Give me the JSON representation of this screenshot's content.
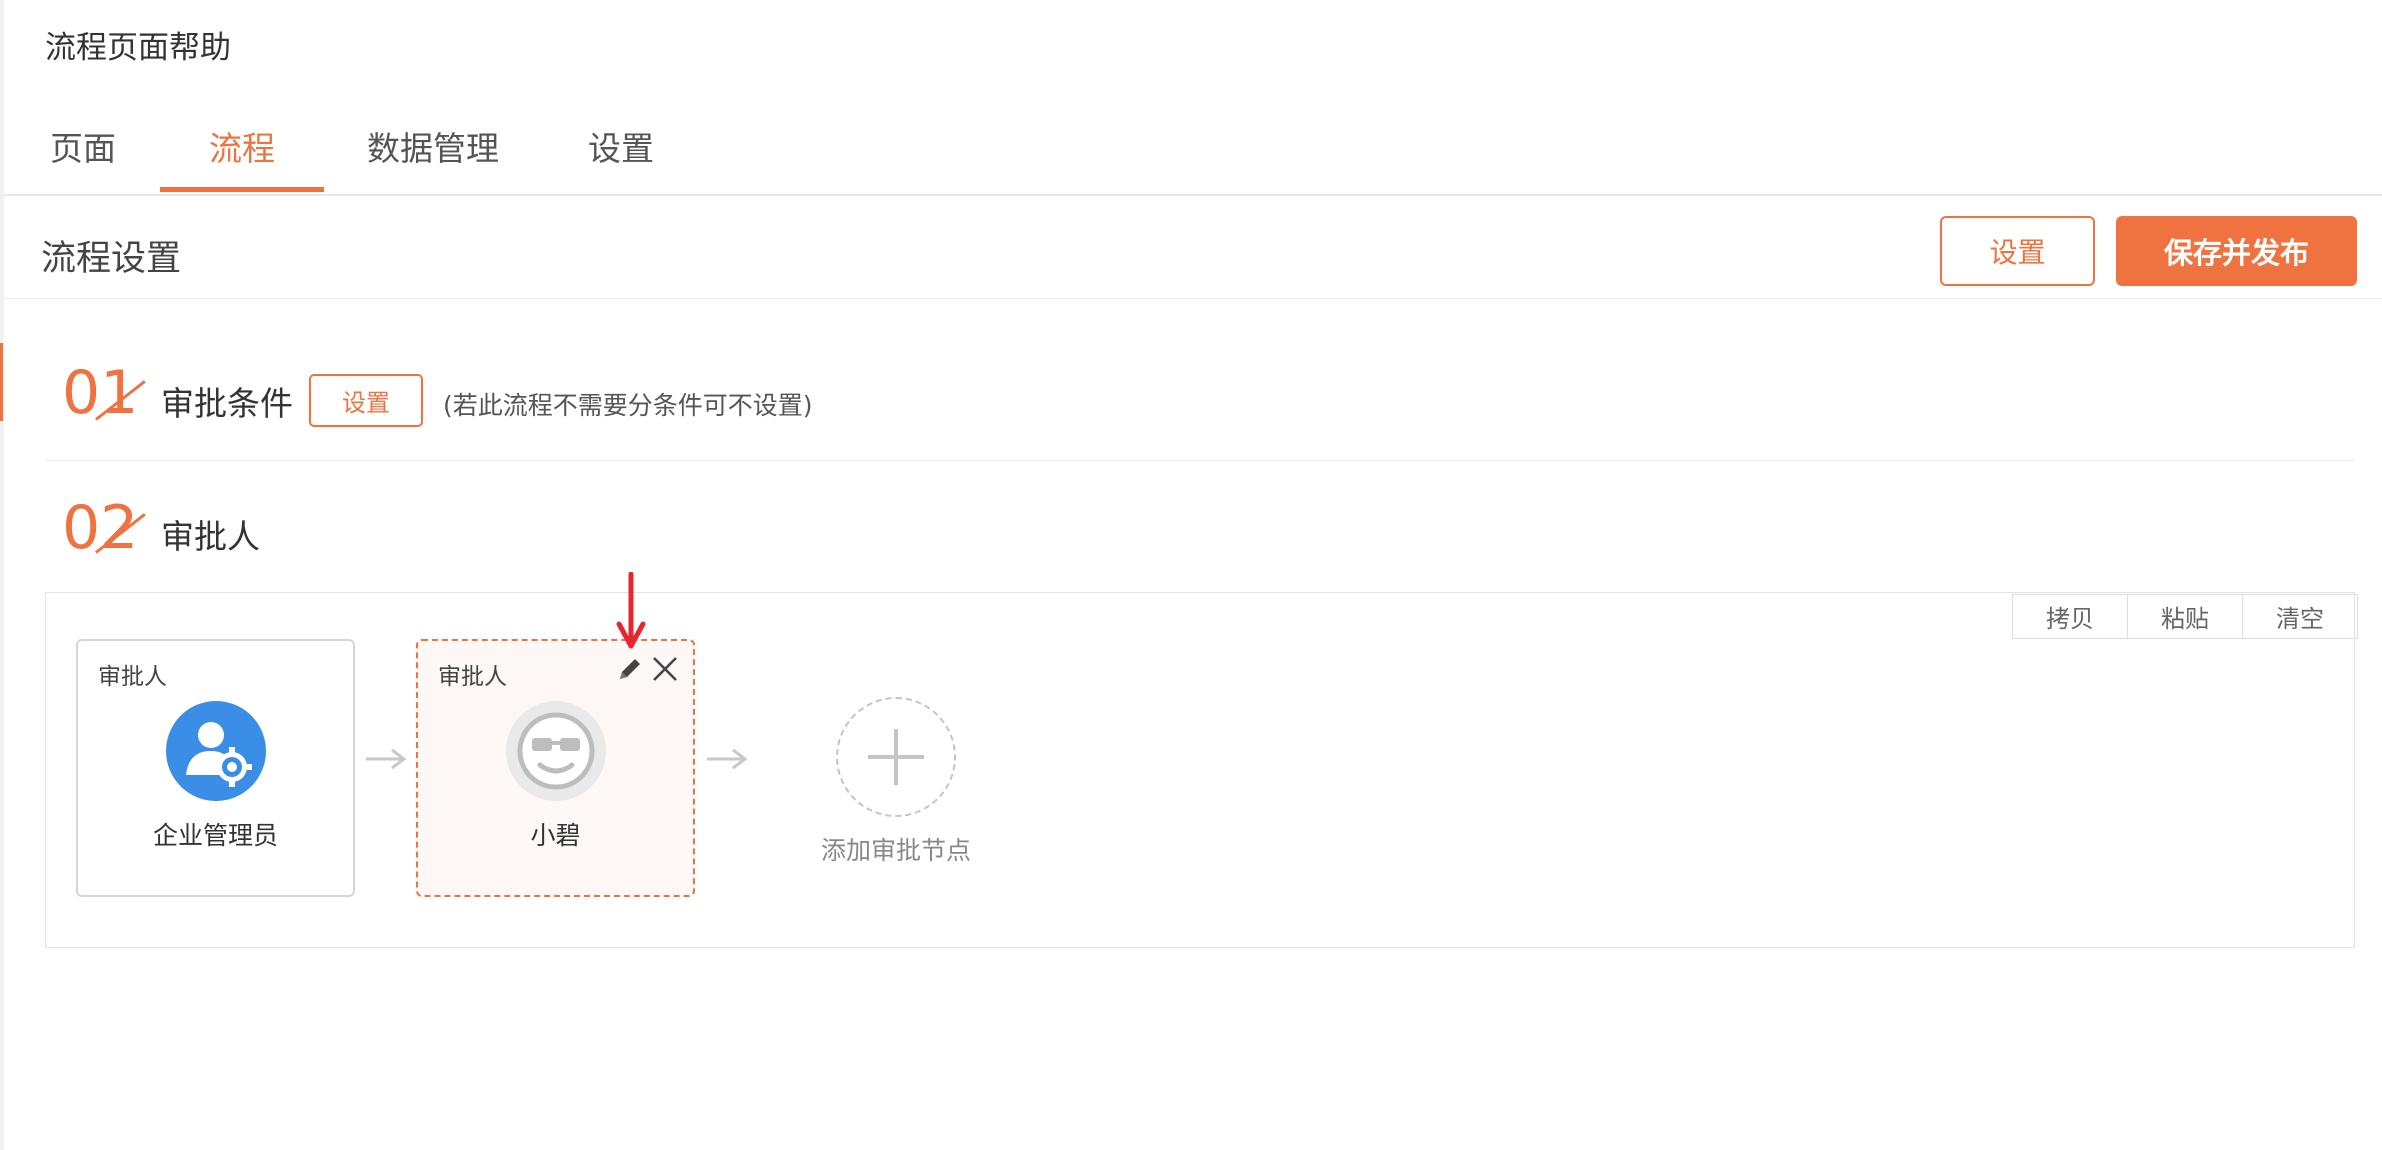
{
  "page": {
    "title": "流程页面帮助"
  },
  "tabs": [
    {
      "label": "页面"
    },
    {
      "label": "流程",
      "active": true
    },
    {
      "label": "数据管理"
    },
    {
      "label": "设置"
    }
  ],
  "header": {
    "title": "流程设置",
    "settings_label": "设置",
    "publish_label": "保存并发布"
  },
  "steps": [
    {
      "number": "01",
      "title": "审批条件",
      "button_label": "设置",
      "note": "(若此流程不需要分条件可不设置)"
    },
    {
      "number": "02",
      "title": "审批人"
    }
  ],
  "toolbar": {
    "copy_label": "拷贝",
    "paste_label": "粘贴",
    "clear_label": "清空"
  },
  "nodes": [
    {
      "type": "审批人",
      "name": "企业管理员",
      "icon": "admin-user-gear-icon"
    },
    {
      "type": "审批人",
      "name": "小碧",
      "icon": "cool-face-avatar-icon",
      "selected": true
    }
  ],
  "add_node": {
    "label": "添加审批节点"
  },
  "colors": {
    "accent": "#ef7341",
    "admin_blue": "#3a8ee6",
    "annotation_red": "#e8262f"
  }
}
